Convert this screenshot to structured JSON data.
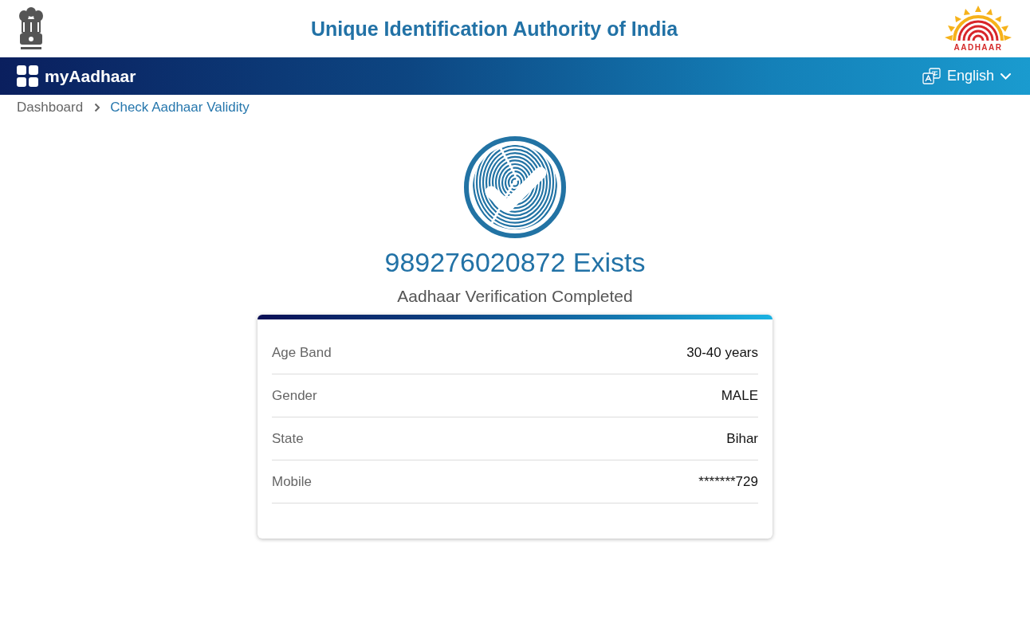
{
  "header": {
    "title": "Unique Identification Authority of India",
    "logo_text": "AADHAAR"
  },
  "navbar": {
    "brand": "myAadhaar",
    "language": "English"
  },
  "breadcrumb": [
    {
      "label": "Dashboard",
      "current": false
    },
    {
      "label": "Check Aadhaar Validity",
      "current": true
    }
  ],
  "result": {
    "heading": "989276020872 Exists",
    "subheading": "Aadhaar Verification Completed"
  },
  "details": [
    {
      "label": "Age Band",
      "value": "30-40 years"
    },
    {
      "label": "Gender",
      "value": "MALE"
    },
    {
      "label": "State",
      "value": "Bihar"
    },
    {
      "label": "Mobile",
      "value": "*******729"
    }
  ]
}
